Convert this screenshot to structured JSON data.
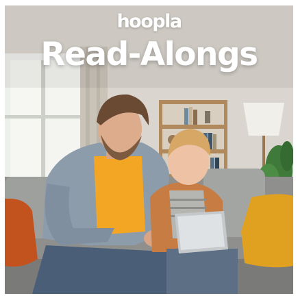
{
  "brand": {
    "logo_text": "hoopla"
  },
  "banner": {
    "headline": "Read-Alongs"
  },
  "colors": {
    "text": "#ffffff",
    "wall": "#dcd9d3",
    "sofa": "#9a9b99",
    "pillow_left": "#c0541e",
    "pillow_right": "#e0a020",
    "man_shirt": "#f2a623",
    "man_jacket": "#8c9cab",
    "child_jacket": "#c77c43"
  }
}
